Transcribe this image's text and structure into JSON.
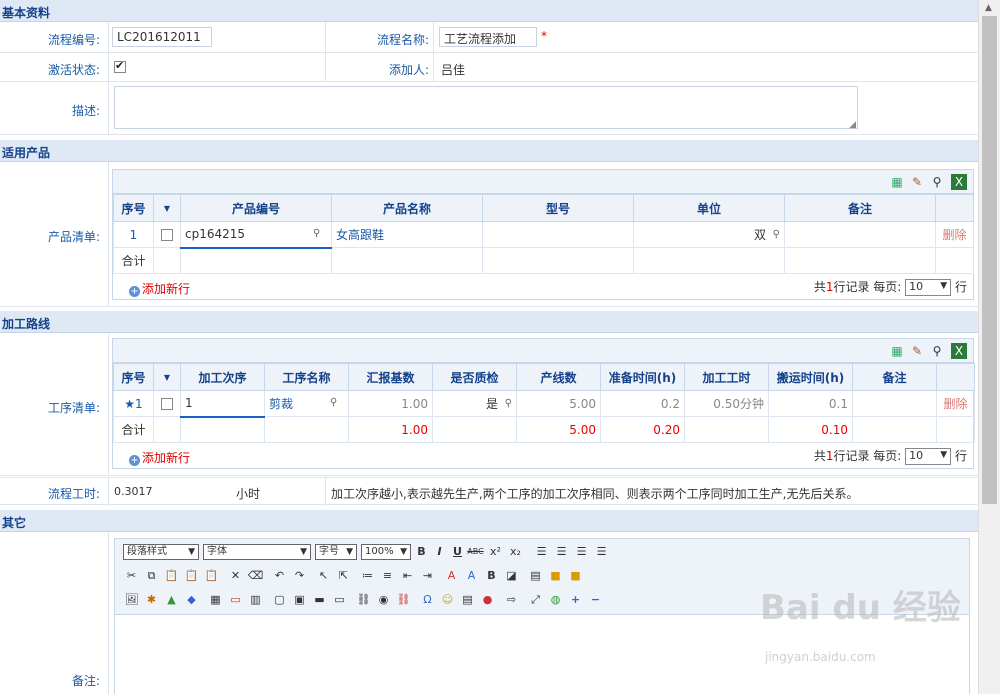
{
  "basic": {
    "section_title": "基本资料",
    "flow_no_label": "流程编号:",
    "flow_no_value": "LC201612011",
    "flow_name_label": "流程名称:",
    "flow_name_value": "工艺流程添加",
    "required_mark": "*",
    "active_label": "激活状态:",
    "added_by_label": "添加人:",
    "added_by_value": "吕佳",
    "desc_label": "描述:"
  },
  "products": {
    "section_title": "适用产品",
    "list_label": "产品清单:",
    "columns": [
      "序号",
      "▼",
      "产品编号",
      "产品名称",
      "型号",
      "单位",
      "备注",
      ""
    ],
    "row": {
      "seq": "1",
      "code": "cp164215",
      "name": "女高跟鞋",
      "model": "",
      "unit": "双",
      "remark": "",
      "action": "删除"
    },
    "total_label": "合计",
    "add_row": "添加新行",
    "pager_prefix": "共",
    "pager_count": "1",
    "pager_suffix": "行记录  每页:",
    "page_size": "10",
    "pager_unit": "行"
  },
  "process": {
    "section_title": "加工路线",
    "list_label": "工序清单:",
    "columns": [
      "序号",
      "▼",
      "加工次序",
      "工序名称",
      "汇报基数",
      "是否质检",
      "产线数",
      "准备时间(h)",
      "加工工时",
      "搬运时间(h)",
      "备注",
      ""
    ],
    "row": {
      "seq": "★1",
      "order": "1",
      "name": "剪裁",
      "base": "1.00",
      "qc": "是",
      "lines": "5.00",
      "prep": "0.2",
      "work": "0.50分钟",
      "move": "0.1",
      "remark": "",
      "action": "删除"
    },
    "total": {
      "label": "合计",
      "base": "1.00",
      "lines": "5.00",
      "prep": "0.20",
      "move": "0.10"
    },
    "add_row": "添加新行",
    "pager_prefix": "共",
    "pager_count": "1",
    "pager_suffix": "行记录  每页:",
    "page_size": "10",
    "pager_unit": "行"
  },
  "flowtime": {
    "label": "流程工时:",
    "value": "0.3017",
    "unit": "小时",
    "note": "加工次序越小,表示越先生产,两个工序的加工次序相同、则表示两个工序同时加工生产,无先后关系。"
  },
  "other": {
    "section_title": "其它",
    "remark_label": "备注:",
    "editor": {
      "para_style": "段落样式",
      "font": "字体",
      "size": "字号",
      "zoom": "100%"
    }
  },
  "watermark": {
    "main": "Bai du 经验",
    "sub": "jingyan.baidu.com"
  }
}
